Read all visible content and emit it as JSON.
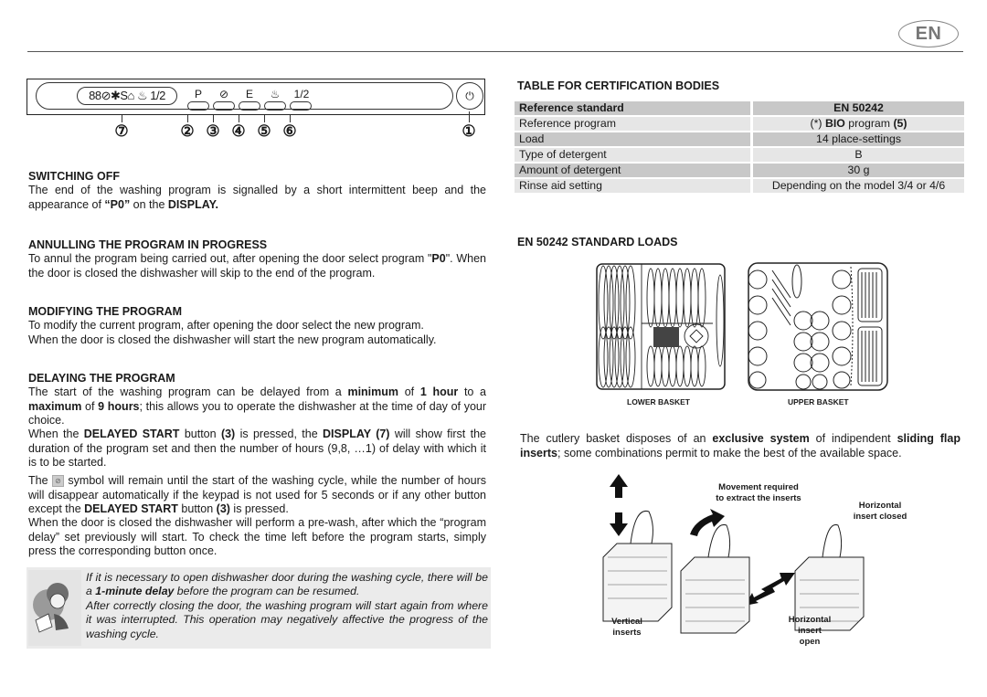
{
  "header": {
    "language_badge": "EN"
  },
  "control_panel": {
    "display_symbols": "88⊘✱S⌂ ♨ 1/2",
    "buttons": [
      {
        "number": "2",
        "symbol": "P"
      },
      {
        "number": "3",
        "symbol": "⊘"
      },
      {
        "number": "4",
        "symbol": "E"
      },
      {
        "number": "5",
        "symbol": "♨"
      },
      {
        "number": "6",
        "symbol": "1/2"
      }
    ],
    "display_number": "7",
    "power_number": "1",
    "power_symbol": "⏻"
  },
  "sections": {
    "switching_off": {
      "title": "SWITCHING OFF",
      "text_1": "The end of the washing program is signalled by a short intermittent beep and the appearance of ",
      "bold_1": "“P0”",
      "text_2": " on the ",
      "bold_2": "DISPLAY."
    },
    "annulling": {
      "title": "ANNULLING THE PROGRAM IN PROGRESS",
      "text_1": "To annul the program being carried out, after opening the door select program \"",
      "bold_1": "P0",
      "text_2": "\". When the door is closed the dishwasher will skip to the end of the program."
    },
    "modifying": {
      "title": "MODIFYING THE PROGRAM",
      "line_1": "To modify the current program, after opening the door select the new program.",
      "line_2": "When the door is closed the dishwasher will start the new program automatically."
    },
    "delaying": {
      "title": "DELAYING THE PROGRAM",
      "p1_a": "The start of the washing program can be delayed from a ",
      "p1_b": "minimum",
      "p1_c": " of ",
      "p1_d": "1 hour",
      "p1_e": " to a ",
      "p1_f": "maximum",
      "p1_g": " of ",
      "p1_h": "9 hours",
      "p1_i": "; this allows you to operate the dishwasher at the time of day of your choice.",
      "p2_a": "When the ",
      "p2_b": "DELAYED START",
      "p2_c": " button ",
      "p2_d": "(3)",
      "p2_e": " is pressed, the ",
      "p2_f": "DISPLAY (7)",
      "p2_g": " will show first the duration of the program set and then the number of hours (9,8, …1) of delay with which it is to be started.",
      "p3_a": "The ",
      "p3_b": " symbol will remain until the start of the washing cycle, while the number of hours will disappear automatically if the keypad is not used for 5 seconds or if any other button except the ",
      "p3_c": "DELAYED START",
      "p3_d": " button ",
      "p3_e": "(3)",
      "p3_f": " is pressed.",
      "p4": "When the door is closed the dishwasher will perform a pre-wash, after which the “program delay” set previously will start. To check the time left before the program starts, simply press the corresponding button once."
    },
    "note": {
      "a": "If it is necessary to open dishwasher door during the washing cycle, there will be a ",
      "b": "1-minute delay",
      "c": " before the program can be resumed.",
      "d": "After correctly closing the door, the washing program will start again from where it was interrupted. This operation may negatively affective the progress of the washing cycle."
    }
  },
  "certification_table": {
    "title": "TABLE FOR CERTIFICATION BODIES",
    "header": [
      "Reference standard",
      "EN 50242"
    ],
    "rows": [
      {
        "label": "Reference program",
        "value_pre": "(*) ",
        "value_bold": "BIO",
        "value_mid": " program ",
        "value_bold2": "(5)"
      },
      {
        "label": "Load",
        "value": "14 place-settings"
      },
      {
        "label": "Type of detergent",
        "value": "B"
      },
      {
        "label": "Amount of detergent",
        "value": "30 g"
      },
      {
        "label": "Rinse aid setting",
        "value": "Depending on the model 3/4 or 4/6"
      }
    ]
  },
  "standard_loads": {
    "title": "EN 50242 STANDARD LOADS",
    "lower_label": "LOWER BASKET",
    "upper_label": "UPPER BASKET"
  },
  "cutlery": {
    "text_a": "The cutlery basket disposes of an ",
    "text_b": "exclusive system",
    "text_c": " of indipendent ",
    "text_d": "sliding flap inserts",
    "text_e": "; some combinations permit to make the best of the available space.",
    "label_movement_1": "Movement required",
    "label_movement_2": "to extract the inserts",
    "label_closed_1": "Horizontal",
    "label_closed_2": "insert closed",
    "label_vertical_1": "Vertical",
    "label_vertical_2": "inserts",
    "label_open_1": "Horizontal",
    "label_open_2": "insert",
    "label_open_3": "open"
  }
}
